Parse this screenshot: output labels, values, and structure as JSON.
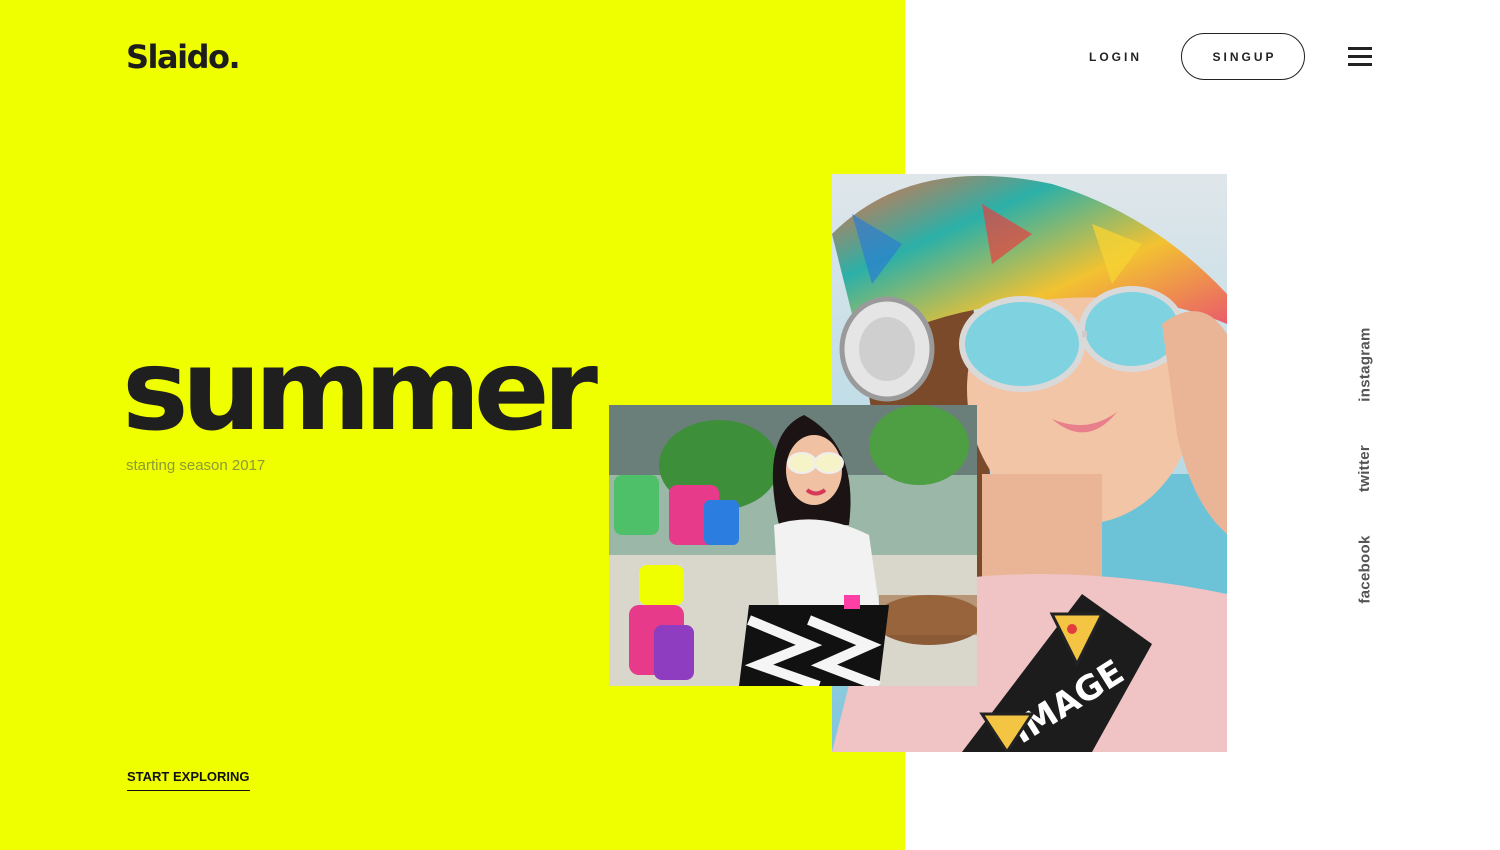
{
  "header": {
    "logo": "Slaido.",
    "login_label": "LOGIN",
    "signup_label": "SINGUP",
    "menu_icon": "hamburger-menu-icon"
  },
  "hero": {
    "headline": "summer",
    "subheadline": "starting season 2017",
    "cta_label": "START EXPLORING"
  },
  "social": {
    "instagram": "instagram",
    "twitter": "twitter",
    "facebook": "facebook"
  },
  "colors": {
    "accent_yellow": "#f0ff00",
    "text_dark": "#1f1f1f",
    "subhead_olive": "#8d9a35",
    "background": "#ffffff"
  }
}
